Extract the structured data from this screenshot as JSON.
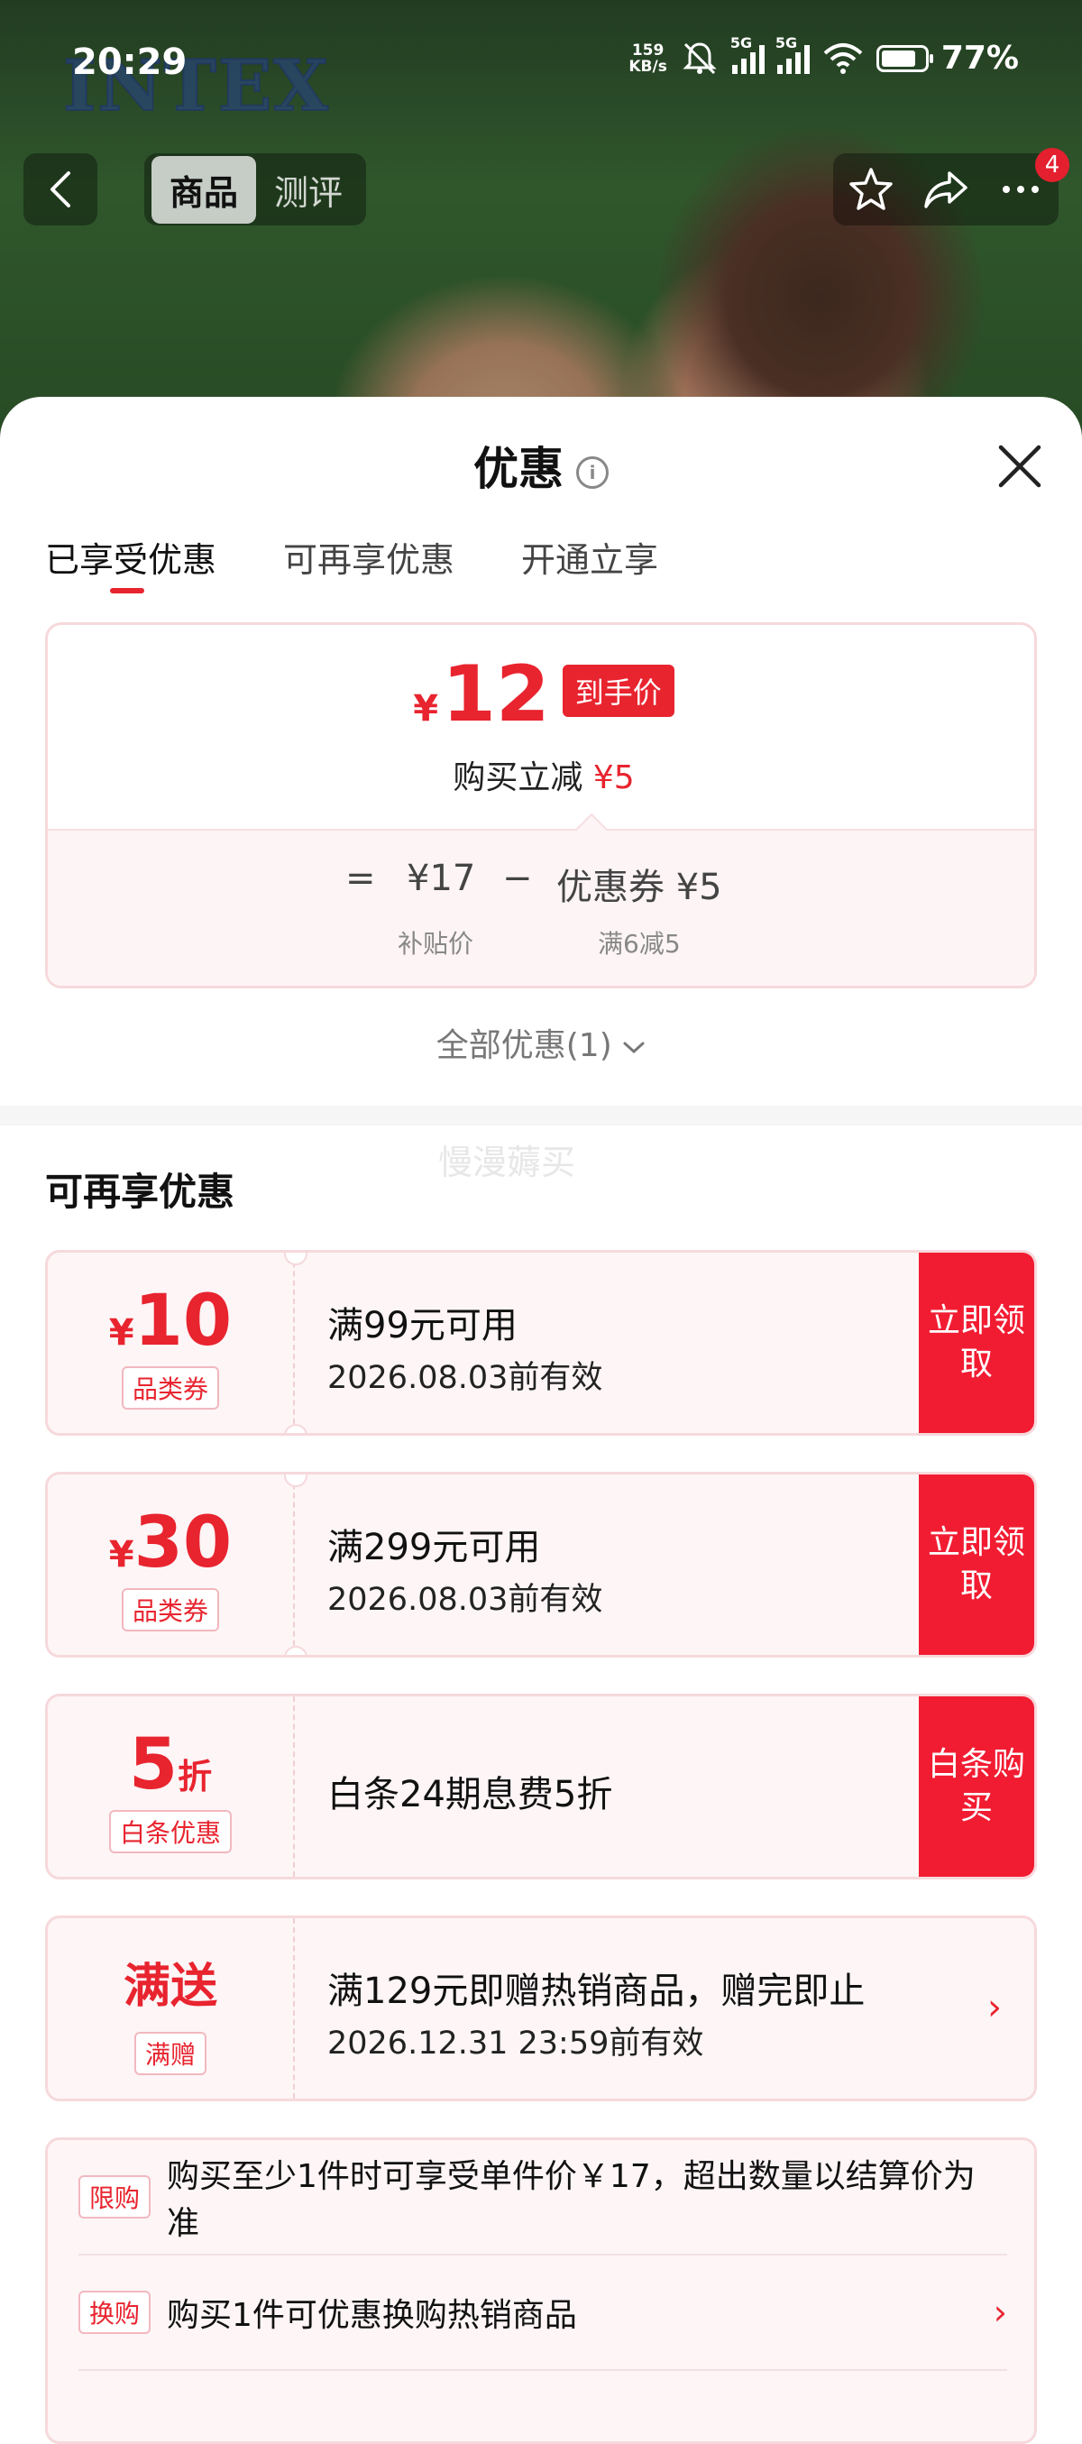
{
  "status_bar": {
    "time": "20:29",
    "speed_value": "159",
    "speed_unit": "KB/s",
    "net1": "5G",
    "net2": "5G",
    "battery": "77%"
  },
  "hero": {
    "brand": "INTEX"
  },
  "nav": {
    "tab_goods": "商品",
    "tab_review": "测评",
    "badge_count": "4"
  },
  "sheet": {
    "title": "优惠",
    "tabs": [
      "已享受优惠",
      "可再享优惠",
      "开通立享"
    ]
  },
  "price_card": {
    "currency": "¥",
    "final_price": "12",
    "price_tag": "到手价",
    "reduce_prefix": "购买立减",
    "reduce_amount": "¥5",
    "calc_equals": "=",
    "calc_base": "¥17",
    "calc_minus": "−",
    "calc_coupon": "优惠券 ¥5",
    "base_label": "补贴价",
    "coupon_label": "满6减5"
  },
  "all_offers": "全部优惠(1)",
  "watermark": "慢漫薅买",
  "section_title": "可再享优惠",
  "coupons": [
    {
      "currency": "¥",
      "amount": "10",
      "kind": "品类券",
      "line1": "满99元可用",
      "line2": "2026.08.03前有效",
      "action": "立即领取"
    },
    {
      "currency": "¥",
      "amount": "30",
      "kind": "品类券",
      "line1": "满299元可用",
      "line2": "2026.08.03前有效",
      "action": "立即领取"
    },
    {
      "amount": "5",
      "unit": "折",
      "kind": "白条优惠",
      "line1": "白条24期息费5折",
      "action": "白条购买"
    },
    {
      "label": "满送",
      "kind": "满赠",
      "line1": "满129元即赠热销商品，赠完即止",
      "line2": "2026.12.31 23:59前有效"
    }
  ],
  "rules": [
    {
      "tag": "限购",
      "text": "购买至少1件时可享受单件价￥17，超出数量以结算价为准"
    },
    {
      "tag": "换购",
      "text": "购买1件可优惠换购热销商品"
    }
  ],
  "colors": {
    "accent": "#e8242f",
    "action_bg": "#f21c32",
    "card_bg": "#fdf5f6"
  }
}
